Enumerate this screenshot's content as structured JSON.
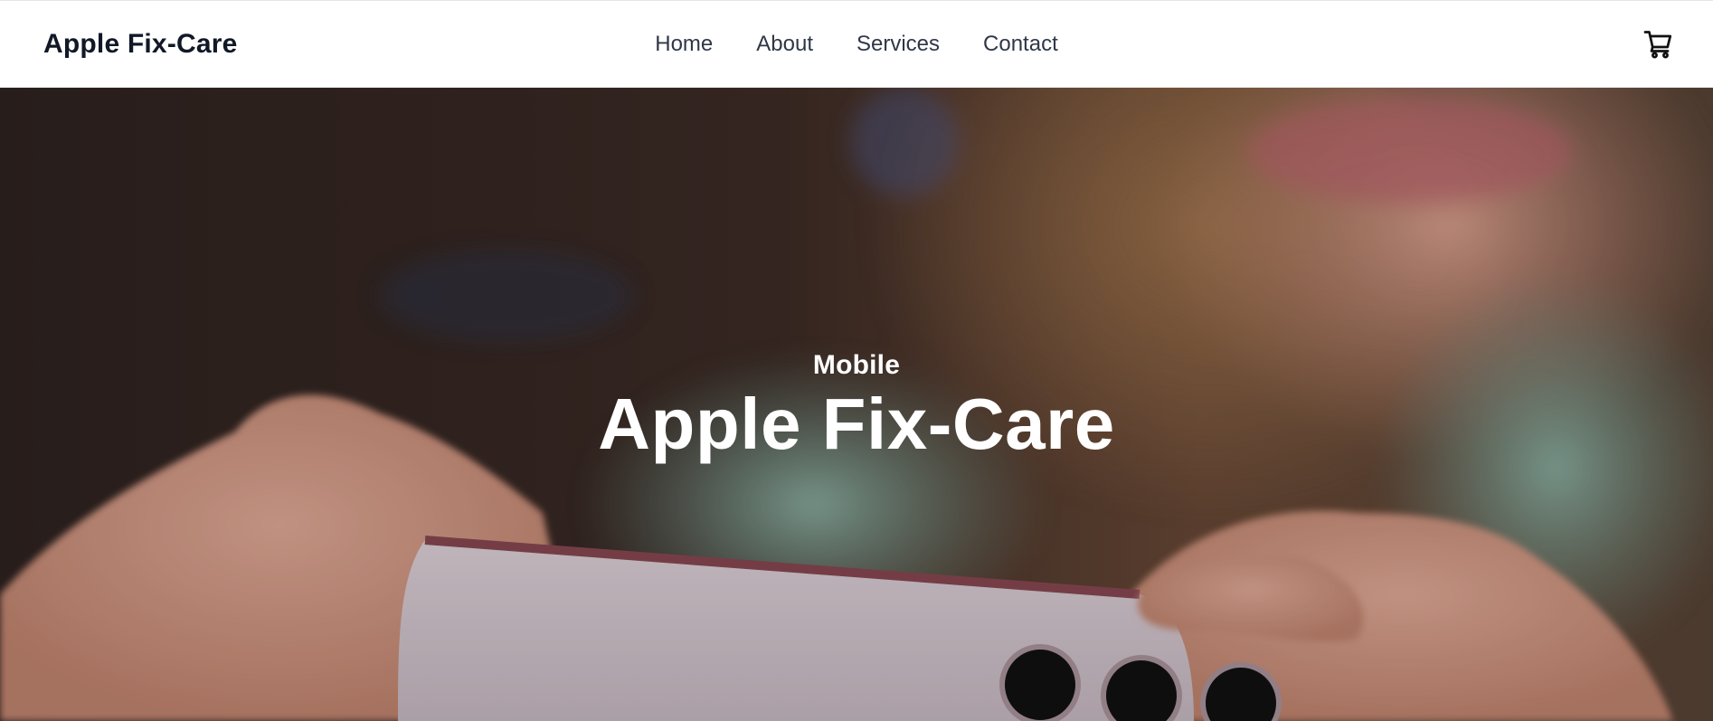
{
  "header": {
    "brand": "Apple Fix-Care",
    "nav": [
      {
        "label": "Home"
      },
      {
        "label": "About"
      },
      {
        "label": "Services"
      },
      {
        "label": "Contact"
      }
    ],
    "cart_icon": "cart-icon"
  },
  "hero": {
    "subtitle": "Mobile",
    "title": "Apple Fix-Care",
    "image_subject": "hero-photo-phone-hands",
    "text_color": "#ffffff"
  },
  "colors": {
    "brand_text": "#111827",
    "nav_text": "#2f3747"
  }
}
